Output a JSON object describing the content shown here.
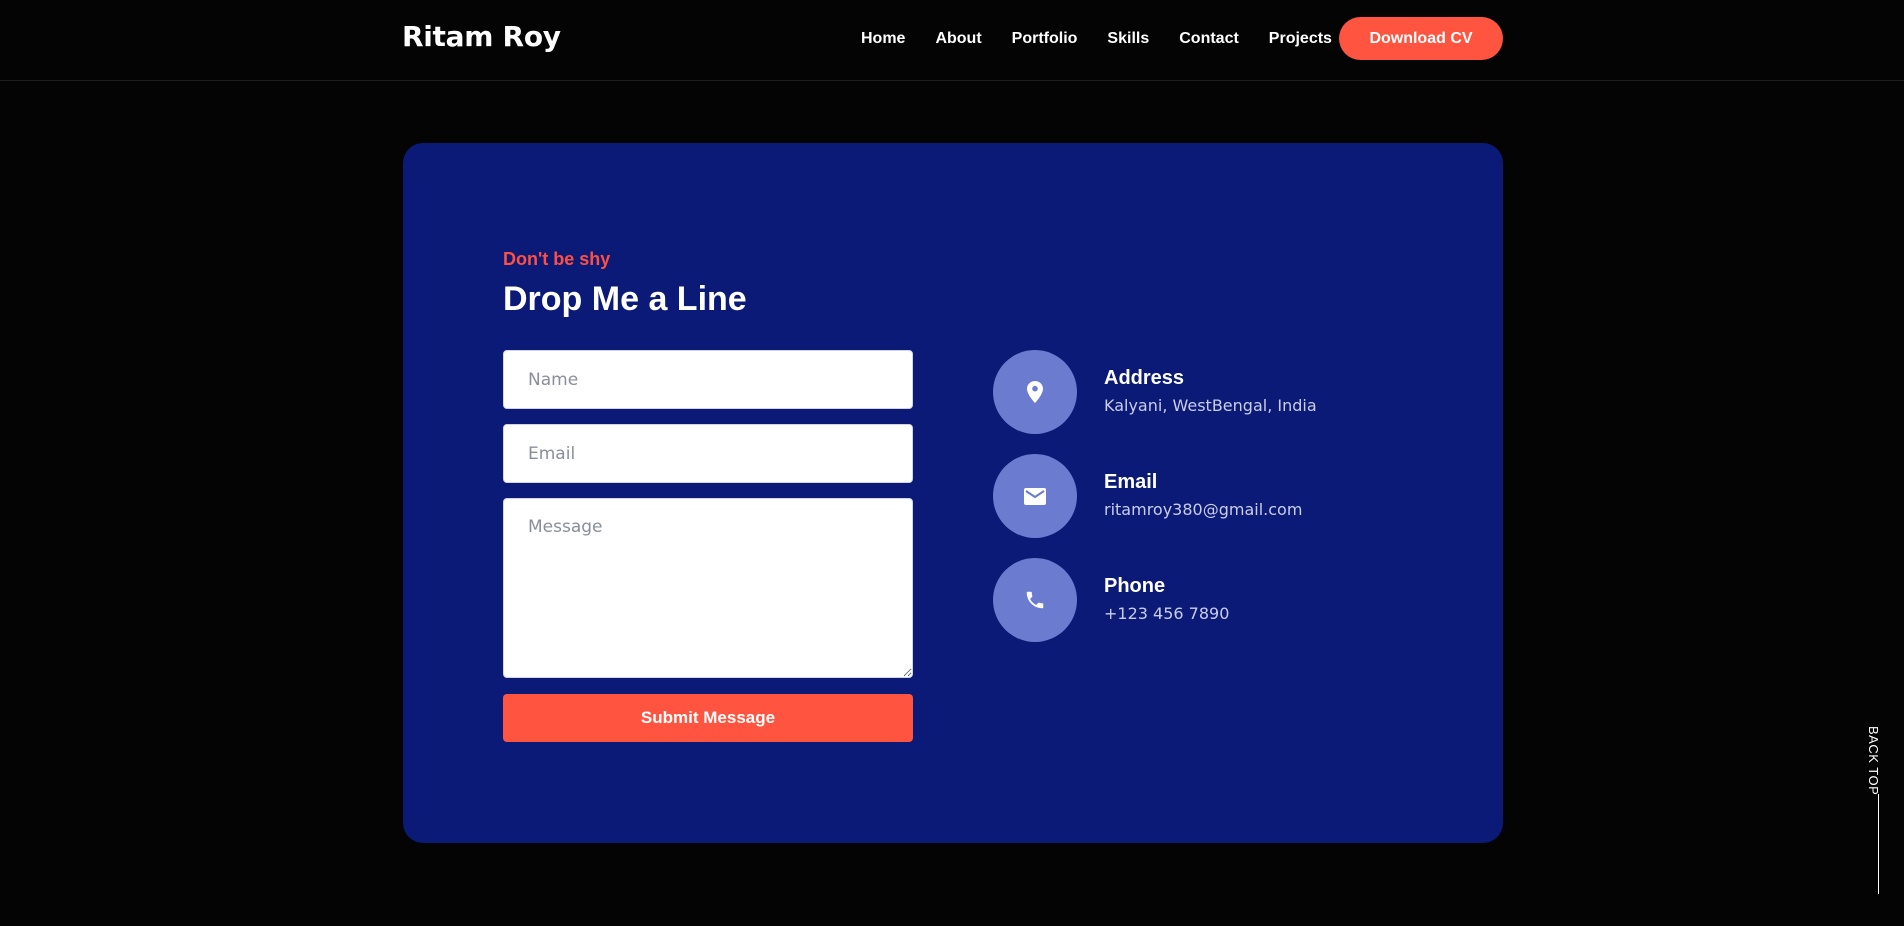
{
  "header": {
    "brand": "Ritam Roy",
    "nav": [
      "Home",
      "About",
      "Portfolio",
      "Skills",
      "Contact",
      "Projects"
    ],
    "cv_button": "Download CV"
  },
  "contact": {
    "eyebrow": "Don't be shy",
    "title": "Drop Me a Line",
    "form": {
      "name_placeholder": "Name",
      "email_placeholder": "Email",
      "message_placeholder": "Message",
      "submit_label": "Submit Message"
    },
    "info": [
      {
        "icon": "location-pin-icon",
        "title": "Address",
        "value": "Kalyani, WestBengal, India"
      },
      {
        "icon": "envelope-icon",
        "title": "Email",
        "value": "ritamroy380@gmail.com"
      },
      {
        "icon": "phone-icon",
        "title": "Phone",
        "value": "+123 456 7890"
      }
    ]
  },
  "back_top": "BACK TOP",
  "colors": {
    "background": "#040404",
    "card": "#0b1a77",
    "accent": "#ff5540",
    "icon_circle": "#6a7bd0"
  }
}
